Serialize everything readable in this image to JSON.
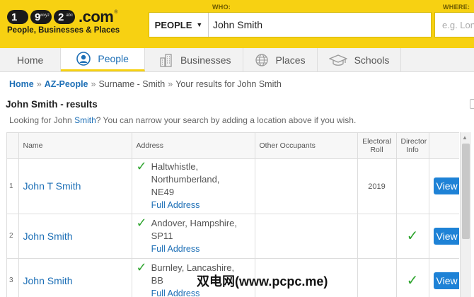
{
  "header": {
    "logo": {
      "digits": [
        {
          "num": "1",
          "sub": ""
        },
        {
          "num": "9",
          "sub": "wxyz"
        },
        {
          "num": "2",
          "sub": "abc"
        }
      ],
      "com": ".com",
      "tm": "®",
      "tagline": "People, Businesses & Places"
    },
    "who_label": "WHO:",
    "where_label": "WHERE:",
    "search_type": "PEOPLE",
    "search_value": "John Smith",
    "where_placeholder": "e.g. London"
  },
  "nav": {
    "tabs": [
      {
        "label": "Home",
        "icon": "none",
        "active": false
      },
      {
        "label": "People",
        "icon": "person-icon",
        "active": true
      },
      {
        "label": "Businesses",
        "icon": "buildings-icon",
        "active": false
      },
      {
        "label": "Places",
        "icon": "globe-icon",
        "active": false
      },
      {
        "label": "Schools",
        "icon": "mortarboard-icon",
        "active": false
      }
    ]
  },
  "breadcrumb": {
    "home": "Home",
    "az_people": "AZ-People",
    "surname": "Surname - Smith",
    "current": "Your results for John Smith",
    "sep": "»"
  },
  "results": {
    "title": "John Smith - results",
    "info_prefix": "Looking for John ",
    "info_highlight": "Smith",
    "info_suffix": "? You can narrow your search by adding a location above if you wish."
  },
  "table": {
    "headers": {
      "name": "Name",
      "address": "Address",
      "occupants": "Other Occupants",
      "electoral_1": "Electoral",
      "electoral_2": "Roll",
      "director_1": "Director",
      "director_2": "Info"
    },
    "full_address_label": "Full Address",
    "view_label": "View",
    "rows": [
      {
        "num": "1",
        "name": "John T Smith",
        "address": [
          "Haltwhistle,",
          "Northumberland,",
          "NE49"
        ],
        "electoral": "2019",
        "director": false
      },
      {
        "num": "2",
        "name": "John Smith",
        "address": [
          "Andover, Hampshire,",
          "SP11"
        ],
        "electoral": "",
        "director": true
      },
      {
        "num": "3",
        "name": "John Smith",
        "address": [
          "Burnley, Lancashire,",
          "BB"
        ],
        "electoral": "",
        "director": true
      }
    ]
  },
  "icons": {
    "check": "✓"
  },
  "watermark": "双电网(www.pcpc.me)",
  "colors": {
    "brand_yellow": "#f7d112",
    "link_blue": "#1d6fb6",
    "button_blue": "#1e82d6",
    "check_green": "#2fa52f"
  }
}
